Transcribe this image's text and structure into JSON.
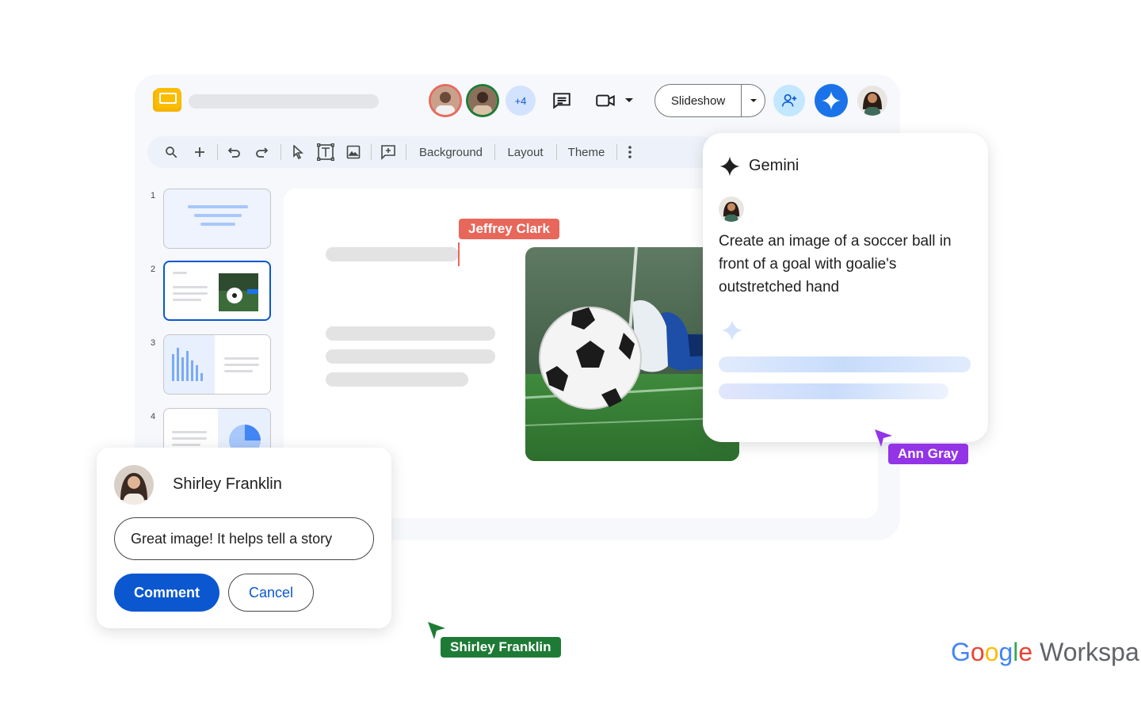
{
  "colors": {
    "accent": "#0b57d0",
    "jeffrey_flag": "#e8675b",
    "ann_flag": "#9334e6",
    "shirley_flag": "#1e7b36"
  },
  "titlebar": {
    "more_collaborators": "+4",
    "slideshow_label": "Slideshow",
    "icons": [
      "slides-logo-icon",
      "comments-icon",
      "video-call-icon",
      "chevron-down-icon",
      "share-icon",
      "gemini-icon"
    ]
  },
  "toolbar": {
    "background_label": "Background",
    "layout_label": "Layout",
    "theme_label": "Theme",
    "icons": [
      "search-icon",
      "plus-icon",
      "undo-icon",
      "redo-icon",
      "select-icon",
      "textbox-icon",
      "image-icon",
      "comment-add-icon",
      "more-vert-icon"
    ]
  },
  "filmstrip": {
    "slides": [
      {
        "number": "1"
      },
      {
        "number": "2"
      },
      {
        "number": "3"
      },
      {
        "number": "4"
      }
    ]
  },
  "cursors": {
    "jeffrey": "Jeffrey Clark",
    "ann": "Ann Gray",
    "shirley": "Shirley Franklin"
  },
  "gemini": {
    "title": "Gemini",
    "prompt": "Create an image of a soccer ball in front of a goal with goalie's outstretched hand"
  },
  "comment": {
    "user": "Shirley Franklin",
    "input_value": "Great image! It helps tell a story",
    "comment_label": "Comment",
    "cancel_label": "Cancel"
  },
  "brand": {
    "google_g1": "G",
    "google_o1": "o",
    "google_o2": "o",
    "google_g2": "g",
    "google_l": "l",
    "google_e": "e",
    "workspace": " Workspa"
  }
}
